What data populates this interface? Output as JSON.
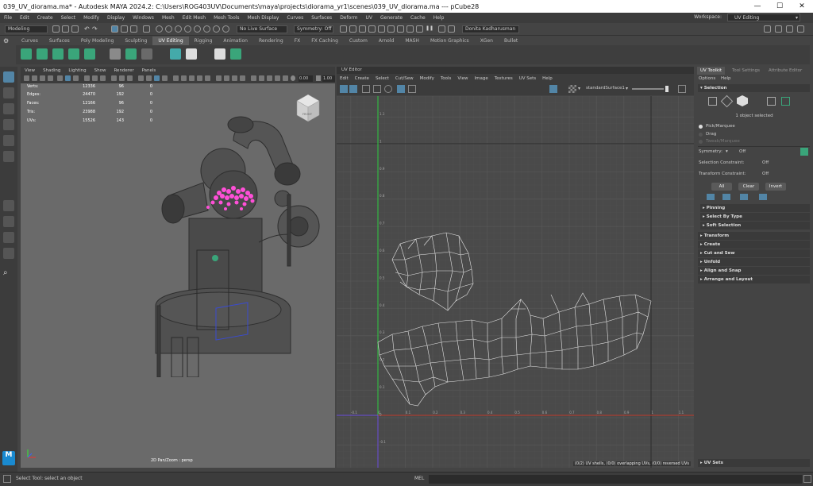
{
  "window": {
    "title": "039_UV_diorama.ma* - Autodesk MAYA 2024.2: C:\\Users\\ROG403UV\\Documents\\maya\\projects\\diorama_yr1\\scenes\\039_UV_diorama.ma   ---   pCube28"
  },
  "menus": [
    "File",
    "Edit",
    "Create",
    "Select",
    "Modify",
    "Display",
    "Windows",
    "Mesh",
    "Edit Mesh",
    "Mesh Tools",
    "Mesh Display",
    "Curves",
    "Surfaces",
    "Deform",
    "UV",
    "Generate",
    "Cache",
    "Help"
  ],
  "workspace": {
    "label": "Workspace:",
    "value": "UV Editing"
  },
  "statusline": {
    "mode": "Modeling",
    "live_surface": "No Live Surface",
    "symmetry": "Symmetry: Off",
    "user": "Donita Kadharusman"
  },
  "shelf_tabs": [
    "Curves",
    "Surfaces",
    "Poly Modeling",
    "Sculpting",
    "UV Editing",
    "Rigging",
    "Animation",
    "Rendering",
    "FX",
    "FX Caching",
    "Custom",
    "Arnold",
    "MASH",
    "Motion Graphics",
    "XGen",
    "Bullet"
  ],
  "shelf_active": "UV Editing",
  "viewport": {
    "menu": [
      "View",
      "Shading",
      "Lighting",
      "Show",
      "Renderer",
      "Panels"
    ],
    "exposure": "0.00",
    "gamma": "1.00",
    "stats": [
      {
        "label": "Verts:",
        "a": "12336",
        "b": "96",
        "c": "0"
      },
      {
        "label": "Edges:",
        "a": "24470",
        "b": "192",
        "c": "0"
      },
      {
        "label": "Faces:",
        "a": "12166",
        "b": "96",
        "c": "0"
      },
      {
        "label": "Tris:",
        "a": "23988",
        "b": "192",
        "c": "0"
      },
      {
        "label": "UVs:",
        "a": "15526",
        "b": "143",
        "c": "0"
      }
    ],
    "cube_label": "FRONT",
    "camera_label": "2D Pan/Zoom : persp"
  },
  "uv_editor": {
    "title": "UV Editor",
    "menu": [
      "Edit",
      "Create",
      "Select",
      "Cut/Sew",
      "Modify",
      "Tools",
      "View",
      "Image",
      "Textures",
      "UV Sets",
      "Help"
    ],
    "texture_set": "standardSurface1",
    "status": "(0/2) UV shells, (0/0) overlapping UVs, (0/0) reversed UVs",
    "x_ticks": [
      "-0.1",
      "0",
      "0.1",
      "0.2",
      "0.3",
      "0.4",
      "0.5",
      "0.6",
      "0.7",
      "0.8",
      "0.9",
      "1",
      "1.1"
    ],
    "y_ticks": [
      "1.1",
      "1",
      "0.9",
      "0.8",
      "0.7",
      "0.6",
      "0.5",
      "0.4",
      "0.3",
      "0.2",
      "0.1",
      "0",
      "-0.1"
    ]
  },
  "uv_toolkit": {
    "tabs": [
      "UV Toolkit",
      "Tool Settings",
      "Attribute Editor"
    ],
    "menu": [
      "Options",
      "Help"
    ],
    "selection_header": "Selection",
    "selected_text": "1 object selected",
    "pick_options": [
      "Pick/Marquee",
      "Drag",
      "Tweak/Marquee"
    ],
    "symmetry_label": "Symmetry:",
    "symmetry_value": "Off",
    "selection_constraint_label": "Selection Constraint:",
    "selection_constraint_value": "Off",
    "transform_constraint_label": "Transform Constraint:",
    "transform_constraint_value": "Off",
    "buttons": [
      "All",
      "Clear",
      "Invert"
    ],
    "subsections": [
      "Pinning",
      "Select By Type",
      "Soft Selection"
    ],
    "sections": [
      "Transform",
      "Create",
      "Cut and Sew",
      "Unfold",
      "Align and Snap",
      "Arrange and Layout"
    ],
    "bottom_section": "UV Sets"
  },
  "command": {
    "lang": "MEL",
    "help_line": "Select Tool: select an object"
  },
  "colors": {
    "accent": "#5285a6",
    "uv_x_axis": "#c0392b",
    "uv_y_axis": "#2ecc40",
    "shelf_green": "#3aa57a",
    "selection_magenta": "#ff4fd8"
  }
}
